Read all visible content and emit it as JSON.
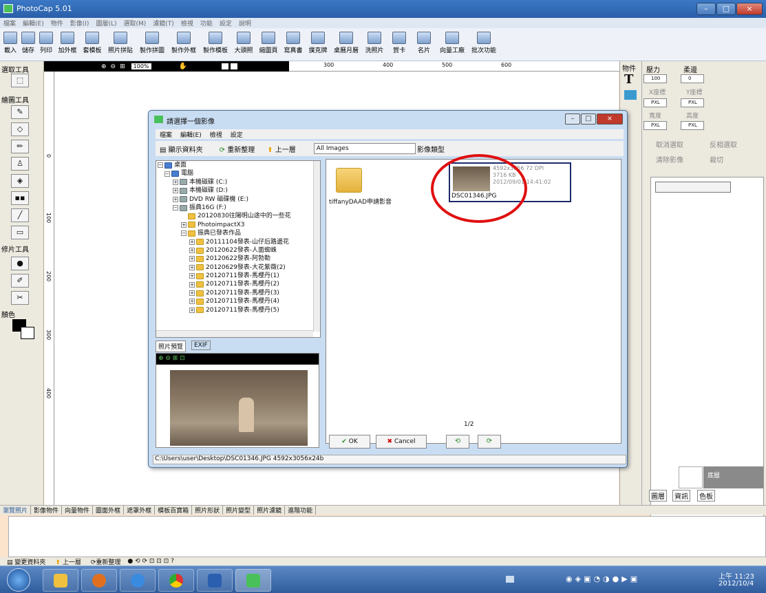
{
  "app": {
    "title": "PhotoCap 5.01",
    "window_buttons": [
      "–",
      "□",
      "×"
    ]
  },
  "menu": [
    "檔案",
    "編輯(E)",
    "物件",
    "影像(I)",
    "圖層(L)",
    "選取(M)",
    "濾鏡(T)",
    "檢視",
    "功能",
    "設定",
    "說明"
  ],
  "toolbar": [
    "載入",
    "儲存",
    "列印",
    "加外框",
    "套模板",
    "照片拼貼",
    "製作拼圖",
    "製作外框",
    "製作模板",
    "大頭照",
    "縮圖頁",
    "寫真書",
    "撲克牌",
    "桌曆月曆",
    "洗照片",
    "賀卡",
    "名片",
    "向量工廠",
    "批次功能"
  ],
  "left": {
    "select_tools": "選取工具",
    "draw_tools": "繪圖工具",
    "retouch_tools": "修片工具",
    "color": "顏色"
  },
  "canvas": {
    "zoom": "100%",
    "ruler_marks": [
      "0",
      "100",
      "200",
      "300",
      "400",
      "500",
      "600"
    ],
    "vruler_marks": [
      "0",
      "100",
      "200",
      "300",
      "400"
    ]
  },
  "right": {
    "object_label": "物件",
    "pressure": "壓力",
    "soft": "柔邊",
    "pressure_val": "100",
    "soft_val": "0",
    "x_label": "X座標",
    "y_label": "Y座標",
    "w_label": "寬度",
    "h_label": "高度",
    "px": "PXL",
    "cancel_select": "取消選取",
    "invert_select": "反相選取",
    "clear_image": "清除影像",
    "crop": "裁切",
    "layer_name": "底層",
    "tabs": [
      "圖層",
      "資訊",
      "色板"
    ]
  },
  "dialog": {
    "title": "請選擇一個影像",
    "menu": [
      "檔案",
      "編輯(E)",
      "檢視",
      "設定"
    ],
    "show_folder": "顯示資料夾",
    "refresh": "重新整理",
    "up": "上一層",
    "filter": "All Images",
    "image_type": "影像類型",
    "tree": [
      "桌面",
      "電腦",
      "本機磁碟 (C:)",
      "本機磁碟 (D:)",
      "DVD RW 磁碟機 (E:)",
      "振典16G (F:)",
      "20120830往陽明山途中的一些花",
      "PhotoimpactX3",
      "振典已發表作品",
      "20111104發表-山仔后路邊花",
      "20120622發表-人面蜘蛛",
      "20120622發表-阿勃勒",
      "20120629發表-大花紫薇(2)",
      "20120711發表-馬櫻丹(1)",
      "20120711發表-馬櫻丹(2)",
      "20120711發表-馬櫻丹(3)",
      "20120711發表-馬櫻丹(4)",
      "20120711發表-馬櫻丹(5)"
    ],
    "preview_tabs": [
      "照片預覽",
      "EXIF"
    ],
    "folder_item": "tiffanyDAAD申請影音",
    "file": {
      "name": "DSC01346.JPG",
      "dims": "4592x3056 72 DPI",
      "size": "3716 KB",
      "date": "2012/09/01 14:41:02"
    },
    "page": "1/2",
    "ok": "OK",
    "cancel": "Cancel",
    "status": "C:\\Users\\user\\Desktop\\DSC01346.JPG  4592x3056x24b"
  },
  "bottom_tabs": [
    "瀏覽照片",
    "影像物件",
    "向量物件",
    "圖面外框",
    "遮罩外框",
    "模板百寶箱",
    "照片形狀",
    "照片變型",
    "照片濾鏡",
    "進階功能"
  ],
  "bottom_tools": {
    "change_folder": "變更資料夾",
    "up": "上一層",
    "refresh": "重新整理"
  },
  "taskbar": {
    "time": "上午 11:23",
    "date": "2012/10/4"
  }
}
